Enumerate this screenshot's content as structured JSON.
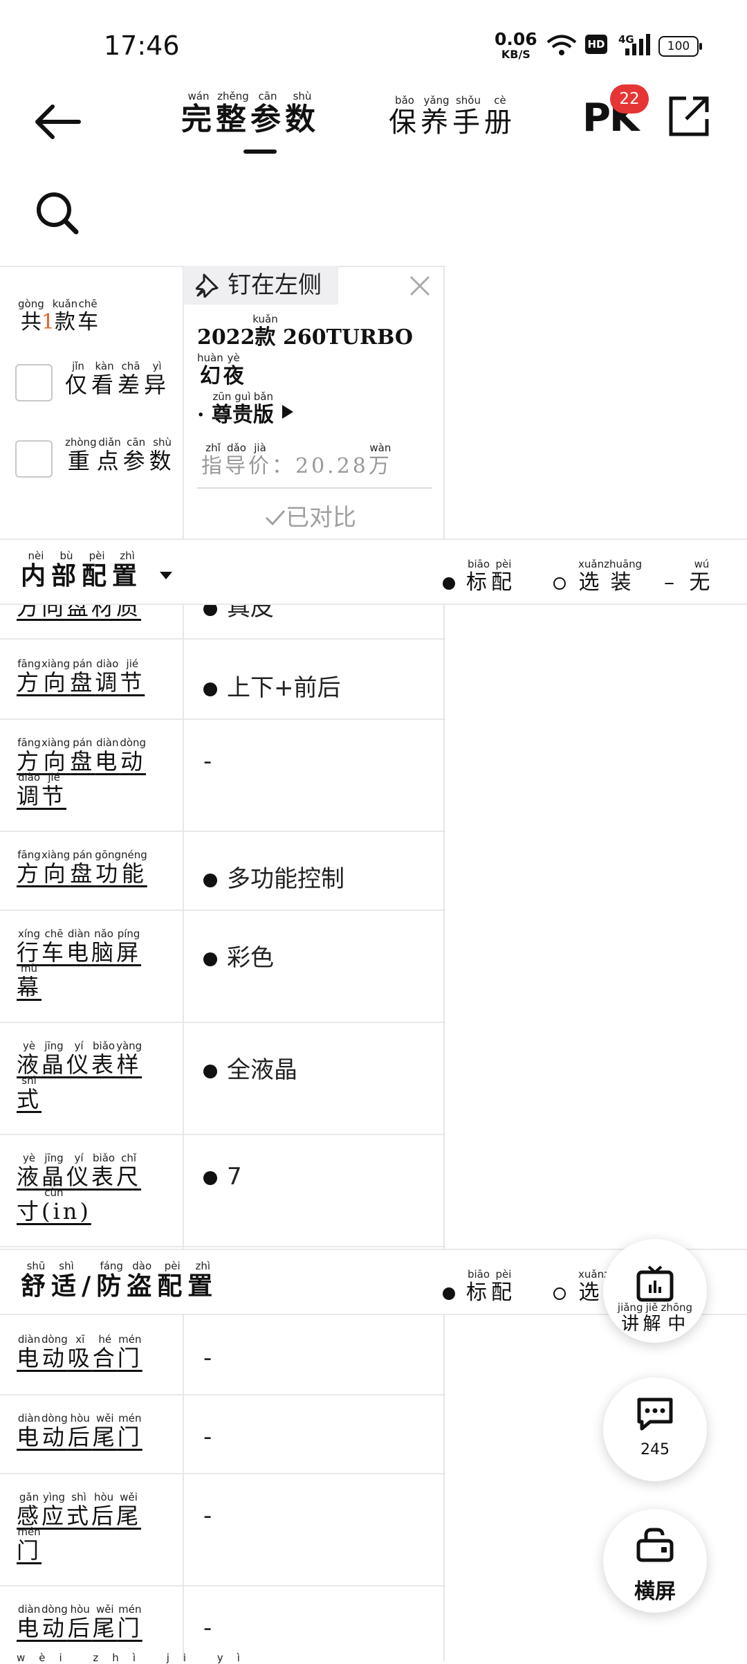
{
  "status": {
    "time": "17:46",
    "speed_value": "0.06",
    "speed_unit": "KB/S",
    "hd": "HD",
    "network": "4G",
    "battery": "100"
  },
  "nav": {
    "tab_full": {
      "chars": [
        "完",
        "整",
        "参",
        "数"
      ],
      "pinyin": [
        "wán",
        "zhěng",
        "cān",
        "shù"
      ]
    },
    "tab_manual": {
      "chars": [
        "保",
        "养",
        "手",
        "册"
      ],
      "pinyin": [
        "bǎo",
        "yǎng",
        "shǒu",
        "cè"
      ]
    },
    "pk_label": "PK",
    "pk_badge": "22"
  },
  "left": {
    "count_prefix": {
      "char": "共",
      "py": "gòng"
    },
    "count_num": "1",
    "count_suffix": {
      "chars": [
        "款",
        "车"
      ],
      "pinyin": [
        "kuǎn",
        "chē"
      ]
    },
    "only_diff": {
      "chars": [
        "仅",
        "看",
        "差",
        "异"
      ],
      "pinyin": [
        "jǐn",
        "kàn",
        "chā",
        "yì"
      ]
    },
    "key_params": {
      "chars": [
        "重",
        "点",
        "参",
        "数"
      ],
      "pinyin": [
        "zhòng",
        "diǎn",
        "cān",
        "shù"
      ]
    }
  },
  "card": {
    "pin_label": "钉在左侧",
    "model_year": "2022",
    "model_kuan": {
      "char": "款",
      "py": "kuǎn"
    },
    "model_name": "260TURBO",
    "model_huanye": {
      "chars": [
        "幻",
        "夜"
      ],
      "pinyin": [
        "huàn",
        "yè"
      ]
    },
    "model_edition": {
      "chars": [
        "尊",
        "贵",
        "版"
      ],
      "pinyin": [
        "zūn",
        "guì",
        "bǎn"
      ]
    },
    "price_label": {
      "chars": [
        "指",
        "导",
        "价"
      ],
      "pinyin": [
        "zhǐ",
        "dǎo",
        "jià"
      ]
    },
    "price_value": "20.28",
    "price_wan": {
      "char": "万",
      "py": "wàn"
    },
    "compared_label": "已对比"
  },
  "legend": {
    "standard": {
      "chars": [
        "标",
        "配"
      ],
      "pinyin": [
        "biāo",
        "pèi"
      ]
    },
    "optional": {
      "chars": [
        "选",
        "装"
      ],
      "pinyin": [
        "xuǎn",
        "zhuāng"
      ]
    },
    "none": {
      "symbol": "–",
      "char": "无",
      "py": "wú"
    }
  },
  "section_interior": {
    "chars": [
      "内",
      "部",
      "配",
      "置"
    ],
    "pinyin": [
      "nèi",
      "bù",
      "pèi",
      "zhì"
    ]
  },
  "section_comfort": {
    "chars": [
      "舒",
      "适",
      "/",
      "防",
      "盗",
      "配",
      "置"
    ],
    "pinyin": [
      "shū",
      "shì",
      "",
      "fáng",
      "dào",
      "pèi",
      "zhì"
    ]
  },
  "partial_row": {
    "label": "方向盘材质",
    "value": "真皮"
  },
  "rows_interior": [
    {
      "chars": [
        "方",
        "向",
        "盘",
        "调",
        "节"
      ],
      "pinyin": [
        "fāng",
        "xiàng",
        "pán",
        "diào",
        "jié"
      ],
      "value": "上下+前后",
      "mark": "standard"
    },
    {
      "chars": [
        "方",
        "向",
        "盘",
        "电",
        "动",
        "调",
        "节"
      ],
      "pinyin": [
        "fāng",
        "xiàng",
        "pán",
        "diàn",
        "dòng",
        "diào",
        "jié"
      ],
      "value": "-",
      "mark": "none"
    },
    {
      "chars": [
        "方",
        "向",
        "盘",
        "功",
        "能"
      ],
      "pinyin": [
        "fāng",
        "xiàng",
        "pán",
        "gōng",
        "néng"
      ],
      "value": "多功能控制",
      "mark": "standard"
    },
    {
      "chars": [
        "行",
        "车",
        "电",
        "脑",
        "屏",
        "幕"
      ],
      "pinyin": [
        "xíng",
        "chē",
        "diàn",
        "nǎo",
        "píng",
        "mù"
      ],
      "value": "彩色",
      "mark": "standard"
    },
    {
      "chars": [
        "液",
        "晶",
        "仪",
        "表",
        "样",
        "式"
      ],
      "pinyin": [
        "yè",
        "jīng",
        "yí",
        "biǎo",
        "yàng",
        "shì"
      ],
      "value": "全液晶",
      "mark": "standard"
    },
    {
      "chars": [
        "液",
        "晶",
        "仪",
        "表",
        "尺",
        "寸(in)"
      ],
      "pinyin": [
        "yè",
        "jīng",
        "yí",
        "biǎo",
        "chǐ",
        "cùn"
      ],
      "value": "7",
      "mark": "standard"
    }
  ],
  "rows_comfort": [
    {
      "chars": [
        "电",
        "动",
        "吸",
        "合",
        "门"
      ],
      "pinyin": [
        "diàn",
        "dòng",
        "xī",
        "hé",
        "mén"
      ],
      "value": "-"
    },
    {
      "chars": [
        "电",
        "动",
        "后",
        "尾",
        "门"
      ],
      "pinyin": [
        "diàn",
        "dòng",
        "hòu",
        "wěi",
        "mén"
      ],
      "value": "-"
    },
    {
      "chars": [
        "感",
        "应",
        "式",
        "后",
        "尾",
        "门"
      ],
      "pinyin": [
        "gǎn",
        "yìng",
        "shì",
        "hòu",
        "wěi",
        "mén"
      ],
      "value": "-"
    },
    {
      "chars": [
        "电",
        "动",
        "后",
        "尾",
        "门"
      ],
      "pinyin": [
        "diàn",
        "dòng",
        "hòu",
        "wěi",
        "mén"
      ],
      "value": "-"
    }
  ],
  "partial_bottom": {
    "pinyin": [
      "wèi",
      "zhì",
      "jì",
      "yì"
    ]
  },
  "fab": {
    "explain": {
      "chars": [
        "讲",
        "解",
        "中"
      ],
      "pinyin": [
        "jiǎng",
        "jiě",
        "zhōng"
      ]
    },
    "comments": "245",
    "landscape": "横屏"
  },
  "colors": {
    "accent_orange": "#e0632a",
    "badge_red": "#e63535",
    "muted": "#a0a0a0"
  }
}
